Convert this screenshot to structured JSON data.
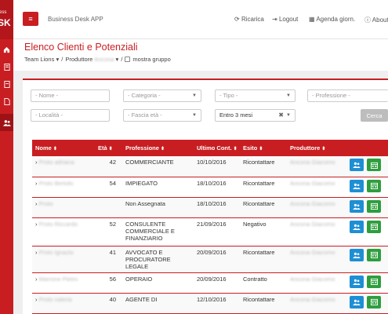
{
  "sidebar": {
    "brand_line1": "usiness",
    "brand_line2": "SK",
    "icons": [
      "home-icon",
      "document-icon",
      "note-icon",
      "file-icon",
      "bookmark-icon",
      "users-icon"
    ]
  },
  "topbar": {
    "menu_icon": "≡",
    "app_title": "Business Desk APP",
    "reload": "Ricarica",
    "logout": "Logout",
    "agenda": "Agenda giorn.",
    "about": "About"
  },
  "header": {
    "title": "Elenco Clienti e Potenziali",
    "team": "Team Lions",
    "producer_label": "Produttore",
    "producer_value": "Ancona",
    "show_group": "mostra gruppo"
  },
  "filters": {
    "nome": "- Nome -",
    "categoria": "- Categoria -",
    "tipo": "- Tipo -",
    "professione": "- Professione -",
    "localita": "- Località -",
    "fascia_eta": "- Fascia età -",
    "periodo": "Entro 3 mesi",
    "cerca": "Cerca"
  },
  "table": {
    "headers": {
      "nome": "Nome",
      "eta": "Età",
      "professione": "Professione",
      "ultimo": "Ultimo Cont.",
      "esito": "Esito",
      "produttore": "Produttore"
    },
    "rows": [
      {
        "nome": "Proto adriana",
        "eta": "42",
        "prof1": "COMMERCIANTE",
        "prof2": "",
        "prof3": "",
        "data": "10/10/2016",
        "esito": "Ricontattare",
        "produttore": "Ancona Giacomo"
      },
      {
        "nome": "Proto Bertolo",
        "eta": "54",
        "prof1": "IMPIEGATO",
        "prof2": "",
        "prof3": "",
        "data": "18/10/2016",
        "esito": "Ricontattare",
        "produttore": "Ancona Giacomo"
      },
      {
        "nome": "Proto",
        "eta": "",
        "prof1": "Non Assegnata",
        "prof2": "",
        "prof3": "",
        "data": "18/10/2016",
        "esito": "Ricontattare",
        "produttore": "Ancona Giacomo"
      },
      {
        "nome": "Proto Riccardo",
        "eta": "52",
        "prof1": "CONSULENTE",
        "prof2": "COMMERCIALE E",
        "prof3": "FINANZIARIO",
        "data": "21/09/2016",
        "esito": "Negativo",
        "produttore": "Ancona Giacomo"
      },
      {
        "nome": "Proto Ignazio",
        "eta": "41",
        "prof1": "AVVOCATO E",
        "prof2": "PROCURATORE LEGALE",
        "prof3": "",
        "data": "20/09/2016",
        "esito": "Ricontattare",
        "produttore": "Ancona Giacomo"
      },
      {
        "nome": "Marrone Pietro",
        "eta": "56",
        "prof1": "OPERAIO",
        "prof2": "",
        "prof3": "",
        "data": "20/09/2016",
        "esito": "Contratto",
        "produttore": "Ancona Giacomo"
      },
      {
        "nome": "Proto valeria",
        "eta": "40",
        "prof1": "AGENTE DI",
        "prof2": "",
        "prof3": "",
        "data": "12/10/2016",
        "esito": "Ricontattare",
        "produttore": "Ancona Giacomo"
      }
    ]
  },
  "colors": {
    "accent": "#c81e22",
    "action_blue": "#1e8fd4",
    "action_green": "#2e9e3e"
  }
}
